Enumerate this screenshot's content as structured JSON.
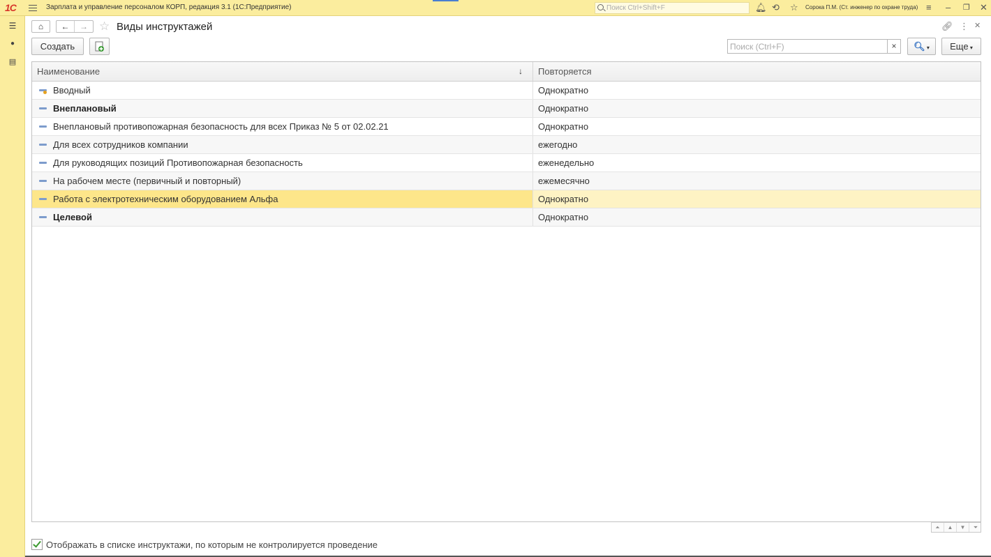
{
  "app": {
    "logo": "1С",
    "title": "Зарплата и управление персоналом КОРП, редакция 3.1  (1С:Предприятие)",
    "global_search_placeholder": "Поиск Ctrl+Shift+F",
    "user": "Сорока П.М. (Ст. инженер по охране труда)"
  },
  "window": {
    "title": "Виды инструктажей"
  },
  "toolbar": {
    "create_label": "Создать",
    "search_placeholder": "Поиск (Ctrl+F)",
    "clear_label": "×",
    "more_label": "Еще"
  },
  "table": {
    "columns": [
      "Наименование",
      "Повторяется"
    ],
    "sort_indicator": "↓",
    "rows": [
      {
        "name": "Вводный",
        "repeat": "Однократно"
      },
      {
        "name": "Внеплановый",
        "repeat": "Однократно"
      },
      {
        "name": "Внеплановый противопожарная безопасность для всех Приказ № 5 от 02.02.21",
        "repeat": "Однократно"
      },
      {
        "name": "Для всех сотрудников компании",
        "repeat": "ежегодно"
      },
      {
        "name": "Для руководящих позиций Противопожарная безопасность",
        "repeat": "еженедельно"
      },
      {
        "name": "На рабочем месте (первичный и повторный)",
        "repeat": "ежемесячно"
      },
      {
        "name": "Работа с электротехническим оборудованием Альфа",
        "repeat": "Однократно"
      },
      {
        "name": "Целевой",
        "repeat": "Однократно"
      }
    ]
  },
  "footer": {
    "checkbox_label": "Отображать в списке инструктажи, по которым не контролируется проведение",
    "checked": true
  },
  "colors": {
    "accent_bar": "#fbed9e",
    "selected_row": "#fde68a",
    "brand_red": "#d8362a"
  }
}
